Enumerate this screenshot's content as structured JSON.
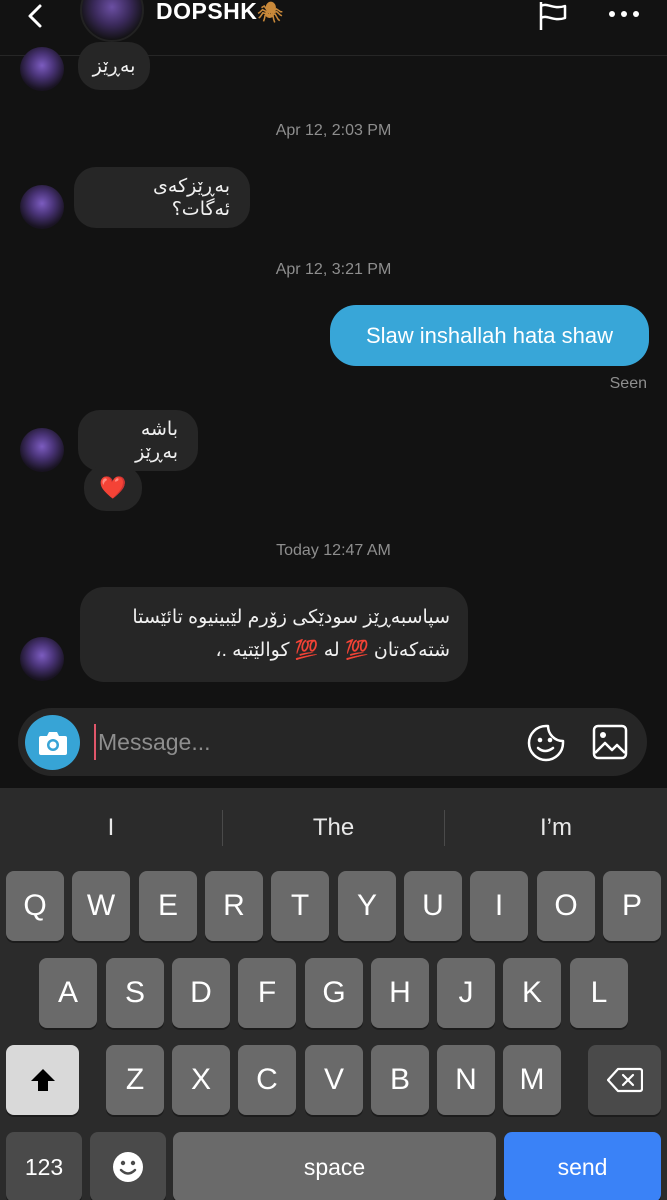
{
  "header": {
    "username": "DOPSHK",
    "emoji": "🕷"
  },
  "messages": {
    "partial_top": "بەڕێز",
    "ts1": "Apr 12, 2:03 PM",
    "msg1": "بەڕێزکەی ئەگات؟",
    "ts2": "Apr 12, 3:21 PM",
    "out1": "Slaw inshallah hata shaw",
    "seen": "Seen",
    "msg2": "باشە بەڕێز",
    "heart": "❤️",
    "ts3": "Today 12:47 AM",
    "msg3_line1": "سپاسبەڕێز سودێکی زۆرم لێبینیوە تائێستا",
    "msg3_line2": "شتەکەتان 💯 لە 💯 کوالێتیە .،"
  },
  "composer": {
    "placeholder": "Message..."
  },
  "keyboard": {
    "suggestions": [
      "I",
      "The",
      "I’m"
    ],
    "row1": [
      "Q",
      "W",
      "E",
      "R",
      "T",
      "Y",
      "U",
      "I",
      "O",
      "P"
    ],
    "row2": [
      "A",
      "S",
      "D",
      "F",
      "G",
      "H",
      "J",
      "K",
      "L"
    ],
    "row3": [
      "Z",
      "X",
      "C",
      "V",
      "B",
      "N",
      "M"
    ],
    "numbers_label": "123",
    "space_label": "space",
    "send_label": "send"
  },
  "colors": {
    "background": "#121212",
    "incoming_bubble": "#262626",
    "outgoing_bubble": "#38a6d8",
    "send_key": "#3a82f7"
  }
}
